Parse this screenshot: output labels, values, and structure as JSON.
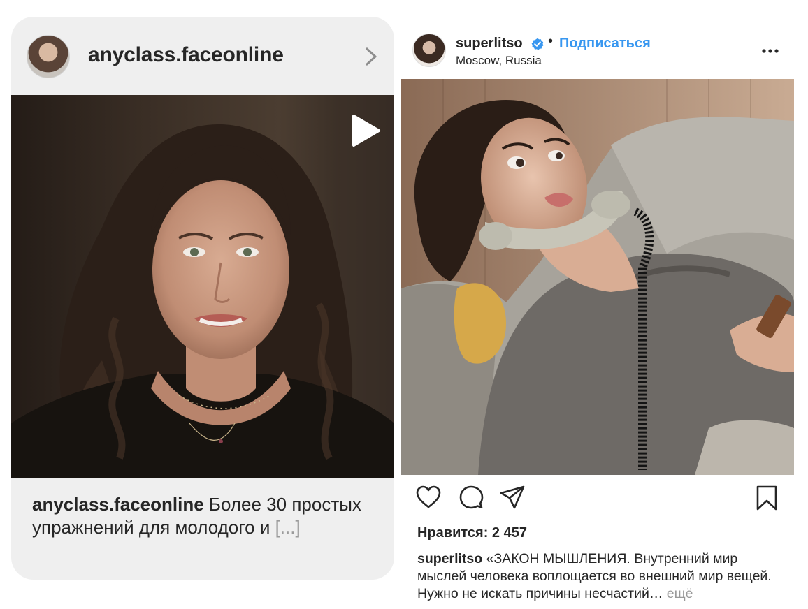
{
  "left_card": {
    "username": "anyclass.faceonline",
    "caption_username": "anyclass.faceonline",
    "caption_text": " Более 30 простых упражнений для молодого и ",
    "caption_more": "[...]",
    "avatar_icon": "profile-avatar",
    "chevron_icon": "chevron-right-icon",
    "play_icon": "play-icon"
  },
  "right_post": {
    "username": "superlitso",
    "verified_icon": "verified-badge-icon",
    "separator": "•",
    "follow_label": "Подписаться",
    "location": "Moscow, Russia",
    "menu_icon": "more-options-icon",
    "likes": "Нравится: 2 457",
    "caption_username": "superlitso",
    "caption_text": " «ЗАКОН МЫШЛЕНИЯ. Внутренний мир мыслей человека воплощается во внешний мир вещей. Нужно не искать причины несчастий… ",
    "caption_more": "ещё",
    "action_icons": [
      "heart-icon",
      "comment-icon",
      "share-icon",
      "bookmark-icon"
    ]
  },
  "colors": {
    "link_blue": "#3897f0",
    "card_bg": "#efefef",
    "text": "#262626",
    "muted": "#9a9a9a"
  }
}
